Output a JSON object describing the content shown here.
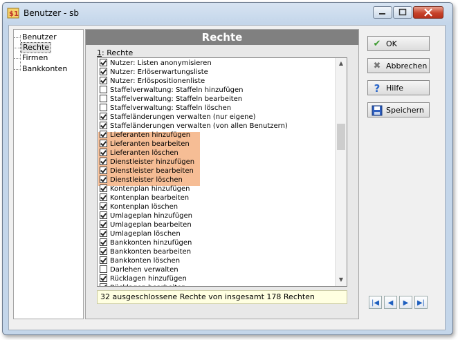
{
  "window": {
    "title": "Benutzer - sb",
    "app_icon": "app-icon",
    "minimize_icon": "minimize-icon",
    "maximize_icon": "maximize-icon",
    "close_icon": "close-icon"
  },
  "tree": {
    "items": [
      {
        "label": "Benutzer",
        "selected": false
      },
      {
        "label": "Rechte",
        "selected": true
      },
      {
        "label": "Firmen",
        "selected": false
      },
      {
        "label": "Bankkonten",
        "selected": false
      }
    ]
  },
  "panel": {
    "header": "Rechte",
    "group_label_prefix": "1",
    "group_label_suffix": ": Rechte",
    "status": "32 ausgeschlossene Rechte von insgesamt 178 Rechten"
  },
  "rights": [
    {
      "label": "Nutzer: Listen anonymisieren",
      "checked": true,
      "highlighted": false
    },
    {
      "label": "Nutzer: Erlöserwartungsliste",
      "checked": true,
      "highlighted": false
    },
    {
      "label": "Nutzer: Erlöspositionenliste",
      "checked": true,
      "highlighted": false
    },
    {
      "label": "Staffelverwaltung: Staffeln hinzufügen",
      "checked": false,
      "highlighted": false
    },
    {
      "label": "Staffelverwaltung: Staffeln bearbeiten",
      "checked": false,
      "highlighted": false
    },
    {
      "label": "Staffelverwaltung: Staffeln löschen",
      "checked": false,
      "highlighted": false
    },
    {
      "label": "Staffeländerungen verwalten (nur eigene)",
      "checked": true,
      "highlighted": false
    },
    {
      "label": "Staffeländerungen verwalten (von allen Benutzern)",
      "checked": true,
      "highlighted": false
    },
    {
      "label": "Lieferanten hinzufügen",
      "checked": true,
      "highlighted": true
    },
    {
      "label": "Lieferanten bearbeiten",
      "checked": true,
      "highlighted": true
    },
    {
      "label": "Lieferanten löschen",
      "checked": true,
      "highlighted": true
    },
    {
      "label": "Dienstleister hinzufügen",
      "checked": true,
      "highlighted": true
    },
    {
      "label": "Dienstleister bearbeiten",
      "checked": true,
      "highlighted": true
    },
    {
      "label": "Dienstleister löschen",
      "checked": true,
      "highlighted": true
    },
    {
      "label": "Kontenplan hinzufügen",
      "checked": true,
      "highlighted": false
    },
    {
      "label": "Kontenplan bearbeiten",
      "checked": true,
      "highlighted": false
    },
    {
      "label": "Kontenplan löschen",
      "checked": true,
      "highlighted": false
    },
    {
      "label": "Umlageplan hinzufügen",
      "checked": true,
      "highlighted": false
    },
    {
      "label": "Umlageplan bearbeiten",
      "checked": true,
      "highlighted": false
    },
    {
      "label": "Umlageplan löschen",
      "checked": true,
      "highlighted": false
    },
    {
      "label": "Bankkonten hinzufügen",
      "checked": true,
      "highlighted": false
    },
    {
      "label": "Bankkonten bearbeiten",
      "checked": true,
      "highlighted": false
    },
    {
      "label": "Bankkonten löschen",
      "checked": true,
      "highlighted": false
    },
    {
      "label": "Darlehen verwalten",
      "checked": false,
      "highlighted": false
    },
    {
      "label": "Rücklagen hinzufügen",
      "checked": true,
      "highlighted": false
    },
    {
      "label": "Rücklagen bearbeiten",
      "checked": true,
      "highlighted": false
    }
  ],
  "buttons": {
    "ok": {
      "label": "OK",
      "icon": "checkmark-icon"
    },
    "cancel": {
      "label": "Abbrechen",
      "icon": "cancel-x-icon"
    },
    "help": {
      "label": "Hilfe",
      "icon": "help-icon"
    },
    "save": {
      "label": "Speichern",
      "icon": "save-disk-icon"
    }
  },
  "nav": {
    "first": "|◀",
    "prev": "◀",
    "next": "▶",
    "last": "▶|"
  },
  "colors": {
    "highlight": "#f4b183",
    "panel_header": "#808080",
    "status_bg": "#ffffe1"
  }
}
